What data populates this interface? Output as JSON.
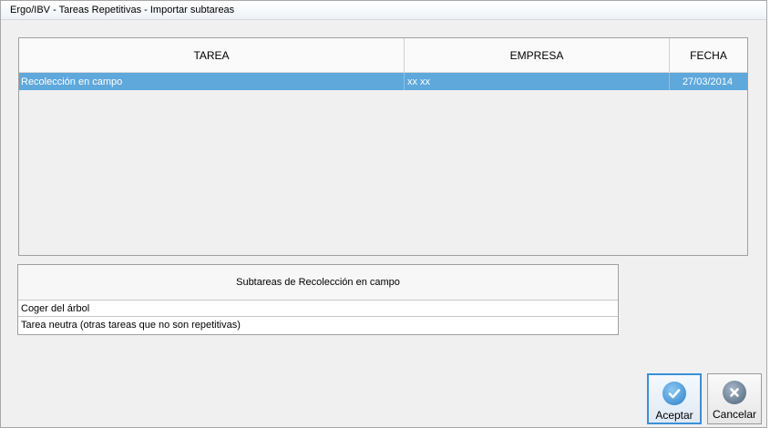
{
  "window": {
    "title": "Ergo/IBV - Tareas Repetitivas - Importar subtareas"
  },
  "tasks_table": {
    "columns": [
      "TAREA",
      "EMPRESA",
      "FECHA"
    ],
    "rows": [
      {
        "tarea": "Recolección en campo",
        "empresa": "xx xx",
        "fecha": "27/03/2014",
        "selected": true
      }
    ]
  },
  "subtasks": {
    "header": "Subtareas de Recolección en campo",
    "items": [
      "Coger del árbol",
      "Tarea neutra (otras tareas que no son repetitivas)"
    ]
  },
  "buttons": {
    "accept_label": "Aceptar",
    "cancel_label": "Cancelar"
  },
  "colors": {
    "selection": "#5ea8dc",
    "accent_border": "#3a8fd8"
  },
  "icons": {
    "accept": "checkmark-icon",
    "cancel": "close-icon"
  }
}
